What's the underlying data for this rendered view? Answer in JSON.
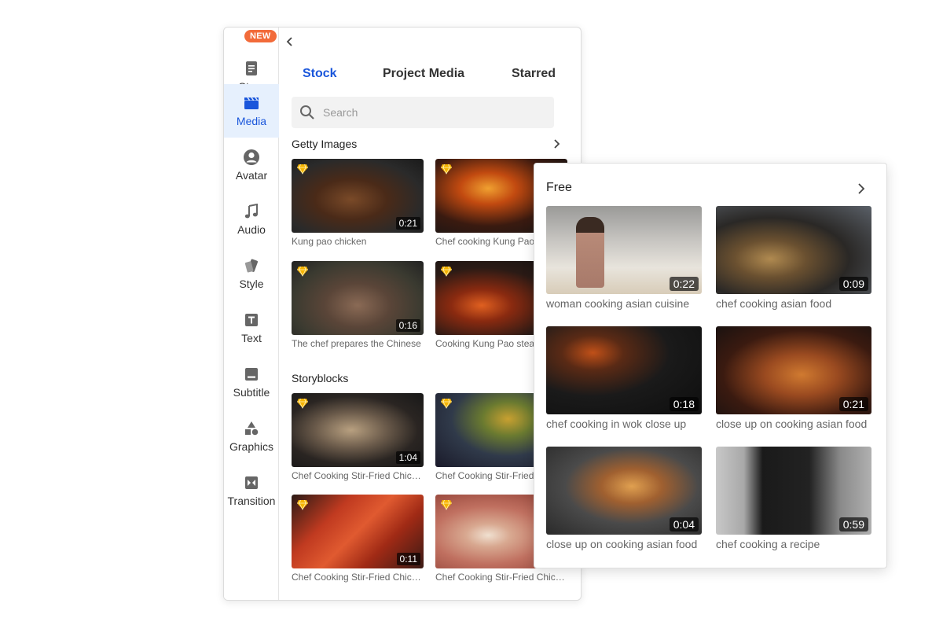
{
  "sidebar": {
    "new_badge": "NEW",
    "items": [
      {
        "label": "Story",
        "icon": "document-icon"
      },
      {
        "label": "Media",
        "icon": "clapperboard-icon"
      },
      {
        "label": "Avatar",
        "icon": "user-circle-icon"
      },
      {
        "label": "Audio",
        "icon": "music-note-icon"
      },
      {
        "label": "Style",
        "icon": "palette-icon"
      },
      {
        "label": "Text",
        "icon": "text-icon"
      },
      {
        "label": "Subtitle",
        "icon": "subtitle-icon"
      },
      {
        "label": "Graphics",
        "icon": "shapes-icon"
      },
      {
        "label": "Transition",
        "icon": "transition-icon"
      }
    ],
    "active": "Media"
  },
  "tabs": [
    {
      "label": "Stock",
      "active": true
    },
    {
      "label": "Project Media",
      "active": false
    },
    {
      "label": "Starred",
      "active": false
    }
  ],
  "search": {
    "placeholder": "Search",
    "value": ""
  },
  "sections": {
    "getty": {
      "title": "Getty Images",
      "items": [
        {
          "caption": "Kung pao chicken",
          "duration": "0:21",
          "premium": true
        },
        {
          "caption": "Chef cooking Kung Pao",
          "duration": "",
          "premium": true
        },
        {
          "caption": "The chef prepares the Chinese",
          "duration": "0:16",
          "premium": true
        },
        {
          "caption": "Cooking Kung Pao steak",
          "duration": "",
          "premium": true
        }
      ]
    },
    "storyblocks": {
      "title": "Storyblocks",
      "items": [
        {
          "caption": "Chef Cooking Stir-Fried Chicken",
          "duration": "1:04",
          "premium": true
        },
        {
          "caption": "Chef Cooking Stir-Fried",
          "duration": "",
          "premium": true
        },
        {
          "caption": "Chef Cooking Stir-Fried Chicken",
          "duration": "0:11",
          "premium": true
        },
        {
          "caption": "Chef Cooking Stir-Fried Chicken",
          "duration": "",
          "premium": true
        }
      ]
    }
  },
  "free": {
    "title": "Free",
    "items": [
      {
        "caption": "woman cooking asian cuisine",
        "duration": "0:22"
      },
      {
        "caption": "chef cooking asian food",
        "duration": "0:09"
      },
      {
        "caption": "chef cooking in wok close up",
        "duration": "0:18"
      },
      {
        "caption": "close up on cooking asian food",
        "duration": "0:21"
      },
      {
        "caption": "close up on cooking asian food",
        "duration": "0:04"
      },
      {
        "caption": "chef cooking a recipe",
        "duration": "0:59"
      }
    ]
  },
  "colors": {
    "accent": "#1a56db",
    "badge": "#f26b3a",
    "gem": "#f5b400"
  }
}
